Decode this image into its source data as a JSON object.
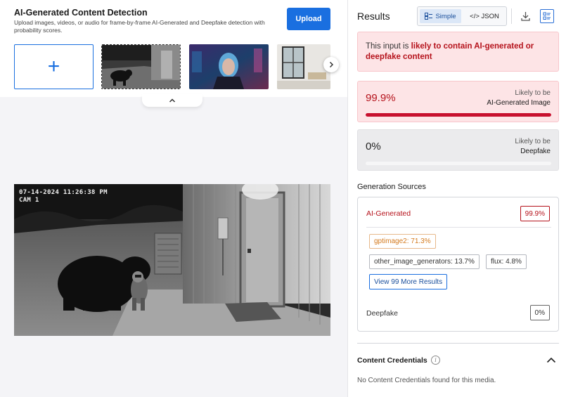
{
  "header": {
    "title": "AI-Generated Content Detection",
    "subtitle": "Upload images, videos, or audio for frame-by-frame AI-Generated and Deepfake detection with probability scores.",
    "upload_label": "Upload",
    "add_symbol": "+"
  },
  "image": {
    "timestamp": "07-14-2024  11:26:38 PM",
    "camera": "CAM 1"
  },
  "results": {
    "title": "Results",
    "toggle_simple": "Simple",
    "toggle_json": "</> JSON",
    "verdict_prefix": "This input is ",
    "verdict_emphasis": "likely to contain AI-generated or deepfake content",
    "ai_score": {
      "value": "99.9%",
      "label_top": "Likely to be",
      "label_main": "AI-Generated Image",
      "fraction": 0.999
    },
    "df_score": {
      "value": "0%",
      "label_top": "Likely to be",
      "label_main": "Deepfake",
      "fraction": 0
    }
  },
  "generation": {
    "title": "Generation Sources",
    "ai_label": "AI-Generated",
    "ai_badge": "99.9%",
    "chips": [
      "gptimage2: 71.3%",
      "other_image_generators: 13.7%",
      "flux: 4.8%"
    ],
    "more_label": "View 99 More Results",
    "df_label": "Deepfake",
    "df_badge": "0%"
  },
  "credentials": {
    "title": "Content Credentials",
    "info_symbol": "i",
    "text": "No Content Credentials found for this media."
  },
  "colors": {
    "accent": "#1a6fe0",
    "danger": "#c8102e",
    "warning": "#d47a1e"
  }
}
